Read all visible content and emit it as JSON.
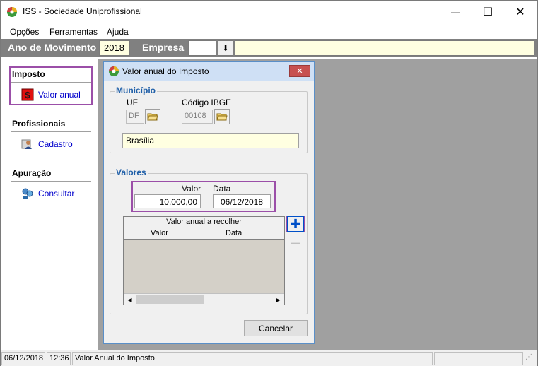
{
  "window": {
    "title": "ISS - Sociedade Uniprofissional",
    "minimize_glyph": "—",
    "maximize_glyph": "☐",
    "close_glyph": "✕"
  },
  "menu": {
    "items": [
      {
        "label": "Opções"
      },
      {
        "label": "Ferramentas"
      },
      {
        "label": "Ajuda"
      }
    ]
  },
  "toolbar": {
    "year_label": "Ano de Movimento",
    "year_value": "2018",
    "empresa_label": "Empresa",
    "empresa_code": "",
    "empresa_name": "",
    "dropdown_glyph": "⬇"
  },
  "sidebar": {
    "sections": [
      {
        "title": "Imposto",
        "items": [
          {
            "label": "Valor anual",
            "icon": "dollar-icon"
          }
        ]
      },
      {
        "title": "Profissionais",
        "items": [
          {
            "label": "Cadastro",
            "icon": "person-icon"
          }
        ]
      },
      {
        "title": "Apuração",
        "items": [
          {
            "label": "Consultar",
            "icon": "people-search-icon"
          }
        ]
      }
    ]
  },
  "dialog": {
    "title": "Valor anual do Imposto",
    "close_glyph": "✕",
    "municipio": {
      "legend": "Município",
      "uf_label": "UF",
      "uf_value": "DF",
      "ibge_label": "Código IBGE",
      "ibge_value": "00108",
      "city_name": "Brasília"
    },
    "valores": {
      "legend": "Valores",
      "valor_label": "Valor",
      "valor_value": "10.000,00",
      "data_label": "Data",
      "data_value": "06/12/2018",
      "grid": {
        "caption": "Valor anual a recolher",
        "columns": [
          "Valor",
          "Data"
        ],
        "rows": []
      },
      "add_glyph": "✚",
      "remove_glyph": "—"
    },
    "cancel_label": "Cancelar"
  },
  "statusbar": {
    "date": "06/12/2018",
    "time": "12:36",
    "message": "Valor Anual do Imposto"
  },
  "colors": {
    "highlight": "#9b4fa8",
    "legend_blue": "#1f5fa8",
    "link_blue": "#0000cc",
    "input_yellow": "#ffffe1",
    "mdi_grey": "#a0a0a0"
  }
}
